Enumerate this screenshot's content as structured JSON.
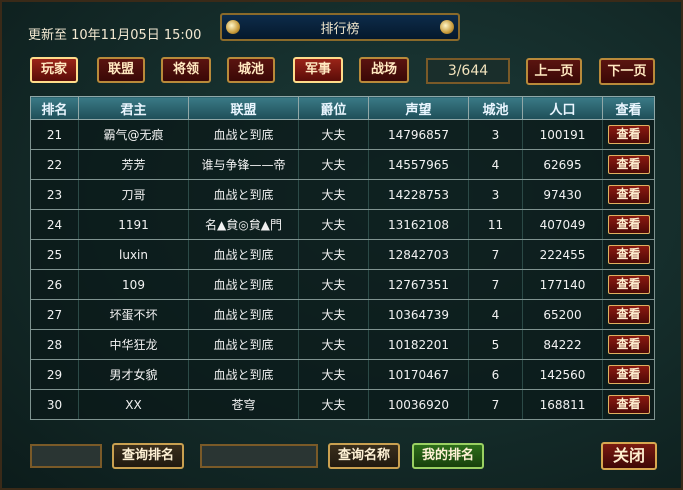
{
  "window": {
    "title": "排行榜",
    "update_time": "更新至 10年11月05日 15:00"
  },
  "tabs": [
    {
      "label": "玩家",
      "active": true
    },
    {
      "label": "联盟",
      "active": false
    },
    {
      "label": "将领",
      "active": false
    },
    {
      "label": "城池",
      "active": false
    },
    {
      "label": "军事",
      "active": true
    },
    {
      "label": "战场",
      "active": false
    }
  ],
  "pagination": {
    "current": "3/644",
    "prev_label": "上一页",
    "next_label": "下一页"
  },
  "table": {
    "headers": [
      "排名",
      "君主",
      "联盟",
      "爵位",
      "声望",
      "城池",
      "人口",
      "查看"
    ],
    "rows": [
      {
        "rank": "21",
        "lord": "霸气@无痕",
        "alliance": "血战と到底",
        "title": "大夫",
        "prestige": "14796857",
        "cities": "3",
        "population": "100191",
        "view": "查看"
      },
      {
        "rank": "22",
        "lord": "芳芳",
        "alliance": "谁与争锋——帝",
        "title": "大夫",
        "prestige": "14557965",
        "cities": "4",
        "population": "62695",
        "view": "查看"
      },
      {
        "rank": "23",
        "lord": "刀哥",
        "alliance": "血战と到底",
        "title": "大夫",
        "prestige": "14228753",
        "cities": "3",
        "population": "97430",
        "view": "查看"
      },
      {
        "rank": "24",
        "lord": "1191",
        "alliance": "名▲貟◎貟▲門",
        "title": "大夫",
        "prestige": "13162108",
        "cities": "11",
        "population": "407049",
        "view": "查看"
      },
      {
        "rank": "25",
        "lord": "luxin",
        "alliance": "血战と到底",
        "title": "大夫",
        "prestige": "12842703",
        "cities": "7",
        "population": "222455",
        "view": "查看"
      },
      {
        "rank": "26",
        "lord": "109",
        "alliance": "血战と到底",
        "title": "大夫",
        "prestige": "12767351",
        "cities": "7",
        "population": "177140",
        "view": "查看"
      },
      {
        "rank": "27",
        "lord": "坏蛋不坏",
        "alliance": "血战と到底",
        "title": "大夫",
        "prestige": "10364739",
        "cities": "4",
        "population": "65200",
        "view": "查看"
      },
      {
        "rank": "28",
        "lord": "中华狂龙",
        "alliance": "血战と到底",
        "title": "大夫",
        "prestige": "10182201",
        "cities": "5",
        "population": "84222",
        "view": "查看"
      },
      {
        "rank": "29",
        "lord": "男才女貌",
        "alliance": "血战と到底",
        "title": "大夫",
        "prestige": "10170467",
        "cities": "6",
        "population": "142560",
        "view": "查看"
      },
      {
        "rank": "30",
        "lord": "XX",
        "alliance": "苍穹",
        "title": "大夫",
        "prestige": "10036920",
        "cities": "7",
        "population": "168811",
        "view": "查看"
      }
    ]
  },
  "footer": {
    "query_rank_label": "查询排名",
    "query_name_label": "查询名称",
    "my_rank_label": "我的排名",
    "close_label": "关闭"
  },
  "colors": {
    "accent_gold": "#c9a050",
    "button_red": "#5a1410",
    "header_teal": "#2d6672"
  }
}
